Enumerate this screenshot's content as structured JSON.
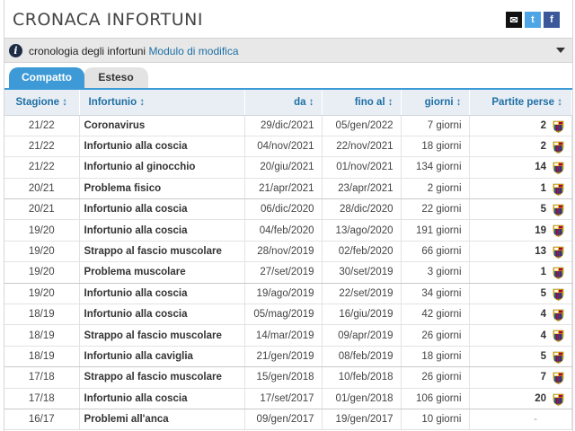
{
  "header": {
    "title": "CRONACA INFORTUNI"
  },
  "social": {
    "mail": "✉",
    "twitter": "t",
    "facebook": "f"
  },
  "infobar": {
    "text": "cronologia degli infortuni",
    "link": "Modulo di modifica",
    "info_glyph": "i"
  },
  "tabs": [
    {
      "label": "Compatto"
    },
    {
      "label": "Esteso"
    }
  ],
  "columns": {
    "season": "Stagione ↕",
    "injury": "Infortunio ↕",
    "from": "da ↕",
    "until": "fino al ↕",
    "days": "giorni ↕",
    "games": "Partite perse ↕"
  },
  "rows": [
    {
      "season": "21/22",
      "injury": "Coronavirus",
      "from": "29/dic/2021",
      "until": "05/gen/2022",
      "days": "7 giorni",
      "games": "2",
      "crest": true
    },
    {
      "season": "21/22",
      "injury": "Infortunio alla coscia",
      "from": "04/nov/2021",
      "until": "22/nov/2021",
      "days": "18 giorni",
      "games": "2",
      "crest": true
    },
    {
      "season": "21/22",
      "injury": "Infortunio al ginocchio",
      "from": "20/giu/2021",
      "until": "01/nov/2021",
      "days": "134 giorni",
      "games": "14",
      "crest": true
    },
    {
      "season": "20/21",
      "injury": "Problema fisico",
      "from": "21/apr/2021",
      "until": "23/apr/2021",
      "days": "2 giorni",
      "games": "1",
      "crest": true
    },
    {
      "season": "20/21",
      "injury": "Infortunio alla coscia",
      "from": "06/dic/2020",
      "until": "28/dic/2020",
      "days": "22 giorni",
      "games": "5",
      "crest": true
    },
    {
      "season": "19/20",
      "injury": "Infortunio alla coscia",
      "from": "04/feb/2020",
      "until": "13/ago/2020",
      "days": "191 giorni",
      "games": "19",
      "crest": true
    },
    {
      "season": "19/20",
      "injury": "Strappo al fascio muscolare",
      "from": "28/nov/2019",
      "until": "02/feb/2020",
      "days": "66 giorni",
      "games": "13",
      "crest": true
    },
    {
      "season": "19/20",
      "injury": "Problema muscolare",
      "from": "27/set/2019",
      "until": "30/set/2019",
      "days": "3 giorni",
      "games": "1",
      "crest": true
    },
    {
      "season": "19/20",
      "injury": "Infortunio alla coscia",
      "from": "19/ago/2019",
      "until": "22/set/2019",
      "days": "34 giorni",
      "games": "5",
      "crest": true
    },
    {
      "season": "18/19",
      "injury": "Infortunio alla coscia",
      "from": "05/mag/2019",
      "until": "16/giu/2019",
      "days": "42 giorni",
      "games": "4",
      "crest": true
    },
    {
      "season": "18/19",
      "injury": "Strappo al fascio muscolare",
      "from": "14/mar/2019",
      "until": "09/apr/2019",
      "days": "26 giorni",
      "games": "4",
      "crest": true
    },
    {
      "season": "18/19",
      "injury": "Infortunio alla caviglia",
      "from": "21/gen/2019",
      "until": "08/feb/2019",
      "days": "18 giorni",
      "games": "5",
      "crest": true
    },
    {
      "season": "17/18",
      "injury": "Strappo al fascio muscolare",
      "from": "15/gen/2018",
      "until": "10/feb/2018",
      "days": "26 giorni",
      "games": "7",
      "crest": true
    },
    {
      "season": "17/18",
      "injury": "Infortunio alla coscia",
      "from": "17/set/2017",
      "until": "01/gen/2018",
      "days": "106 giorni",
      "games": "20",
      "crest": true
    },
    {
      "season": "16/17",
      "injury": "Problemi all'anca",
      "from": "09/gen/2017",
      "until": "19/gen/2017",
      "days": "10 giorni",
      "games": "-",
      "crest": false
    }
  ],
  "colors": {
    "accent": "#3d9ad7",
    "link": "#1d6fa5",
    "crest_red": "#a50044",
    "crest_blue": "#004d98",
    "crest_gold": "#edbb00"
  }
}
